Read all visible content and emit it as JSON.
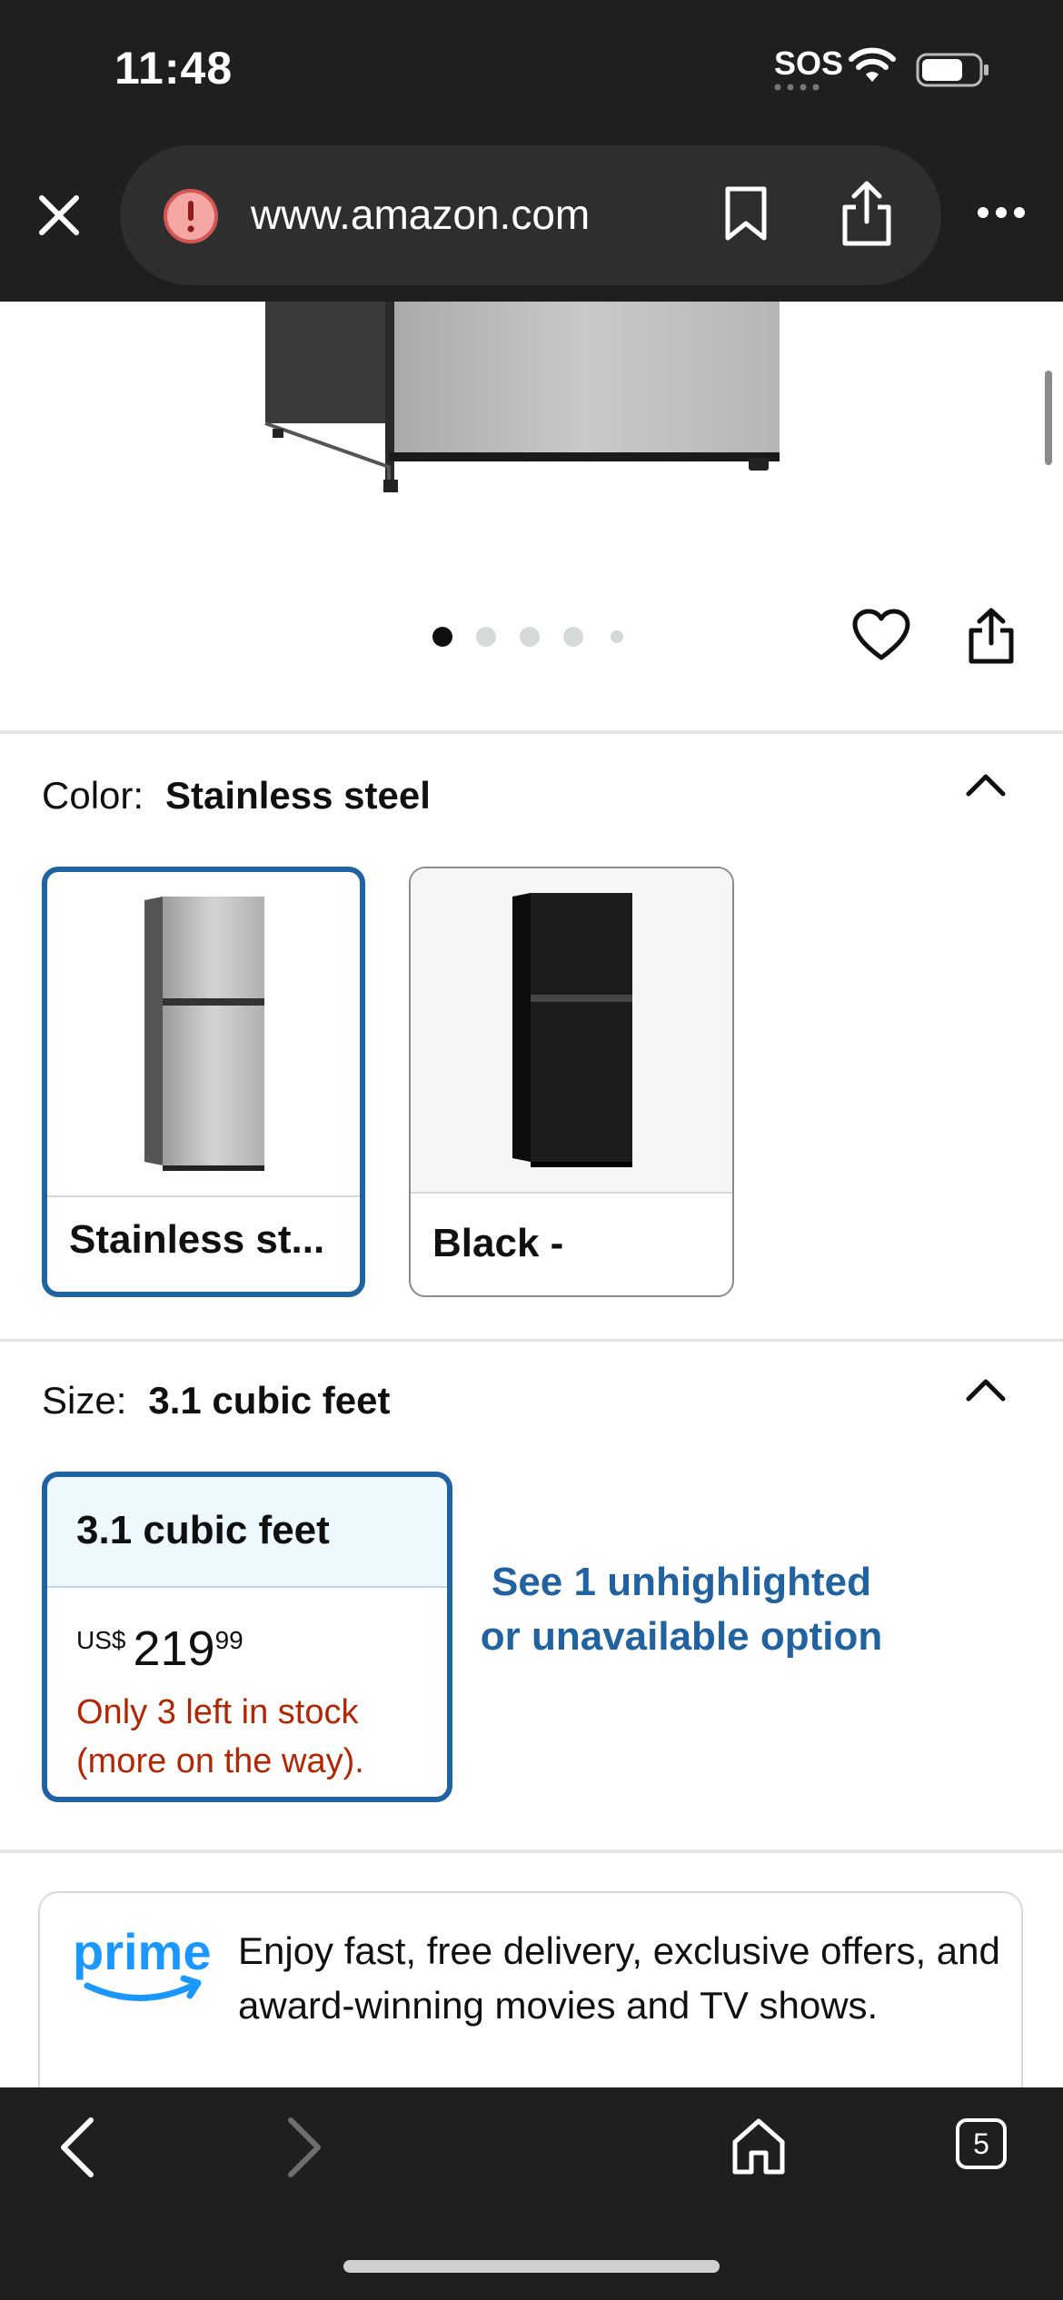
{
  "status_bar": {
    "time": "11:48",
    "sos": "SOS",
    "icons": [
      "wifi-icon",
      "battery-icon"
    ]
  },
  "browser": {
    "url": "www.amazon.com",
    "icons": [
      "close-icon",
      "warning-icon",
      "bookmark-icon",
      "share-icon",
      "more-icon"
    ]
  },
  "gallery": {
    "image_count": 5,
    "active_index": 0,
    "icons": [
      "heart-icon",
      "share-icon"
    ]
  },
  "color": {
    "label": "Color:",
    "selected_value": "Stainless steel",
    "options": [
      {
        "name": "Stainless st...",
        "selected": true,
        "finish": "#c4c4c4"
      },
      {
        "name": "Black -",
        "selected": false,
        "finish": "#1c1c1c"
      }
    ]
  },
  "size": {
    "label": "Size:",
    "selected_value": "3.1 cubic feet",
    "option": {
      "title": "3.1 cubic feet",
      "currency": "US$",
      "price_whole": "219",
      "price_fraction": "99",
      "stock": "Only 3 left in stock (more on the way)."
    },
    "see_more": "See 1 unhighlighted or unavailable option"
  },
  "prime": {
    "logo": "prime",
    "text": "Enjoy fast, free delivery, exclusive offers, and award-winning movies and TV shows."
  },
  "toolbar": {
    "tab_count": "5",
    "icons": [
      "back-icon",
      "forward-icon",
      "home-icon",
      "tabs-icon"
    ]
  },
  "colors": {
    "accent": "#2162a1",
    "stock_red": "#b12704",
    "prime_blue": "#1a98ff",
    "chrome_dark": "#1f1f1f"
  }
}
